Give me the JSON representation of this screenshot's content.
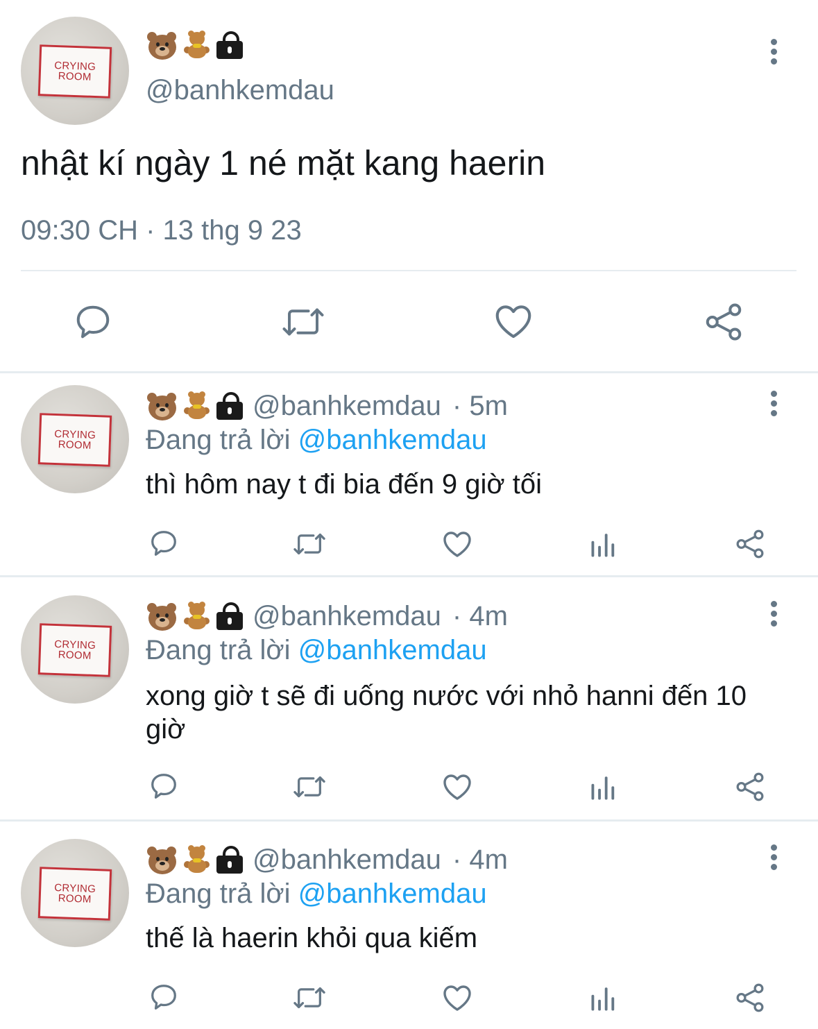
{
  "main_tweet": {
    "avatar_text_line1": "CRYING",
    "avatar_text_line2": "ROOM",
    "handle": "@banhkemdau",
    "text": "nhật kí ngày 1 né mặt kang haerin",
    "timestamp": "09:30 CH · 13 thg 9 23",
    "icons": [
      "bear-face-icon",
      "teddy-bear-icon",
      "lock-icon"
    ],
    "actions": [
      "reply-icon",
      "retweet-icon",
      "like-icon",
      "share-icon"
    ]
  },
  "replies": [
    {
      "handle": "@banhkemdau",
      "time": "· 5m",
      "replying_prefix": "Đang trả lời",
      "replying_to": "@banhkemdau",
      "text": "thì hôm nay t đi bia đến 9 giờ tối"
    },
    {
      "handle": "@banhkemdau",
      "time": "· 4m",
      "replying_prefix": "Đang trả lời",
      "replying_to": "@banhkemdau",
      "text": "xong giờ t sẽ đi uống nước với nhỏ hanni đến 10 giờ"
    },
    {
      "handle": "@banhkemdau",
      "time": "· 4m",
      "replying_prefix": "Đang trả lời",
      "replying_to": "@banhkemdau",
      "text": "thế là haerin khỏi qua kiếm"
    }
  ],
  "colors": {
    "accent": "#1da1f2",
    "muted": "#657786",
    "divider": "#e6ecf0",
    "icon": "#657786"
  }
}
